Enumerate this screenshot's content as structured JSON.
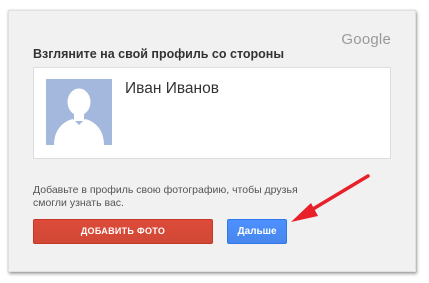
{
  "brand": {
    "logo_text": "Google"
  },
  "dialog": {
    "heading": "Взгляните на свой профиль со стороны",
    "profile": {
      "name": "Иван Иванов",
      "avatar_icon": "default-person-silhouette-icon"
    },
    "hint": "Добавьте в профиль свою фотографию, чтобы друзья смогли узнать вас.",
    "buttons": {
      "add_photo": "ДОБАВИТЬ ФОТО",
      "next": "Дальше"
    }
  },
  "annotation": {
    "arrow_icon": "red-arrow-icon",
    "arrow_color": "#e8202a"
  },
  "colors": {
    "add_button": "#d14836",
    "next_button": "#4d90fe",
    "avatar_bg": "#a4b8dd"
  }
}
